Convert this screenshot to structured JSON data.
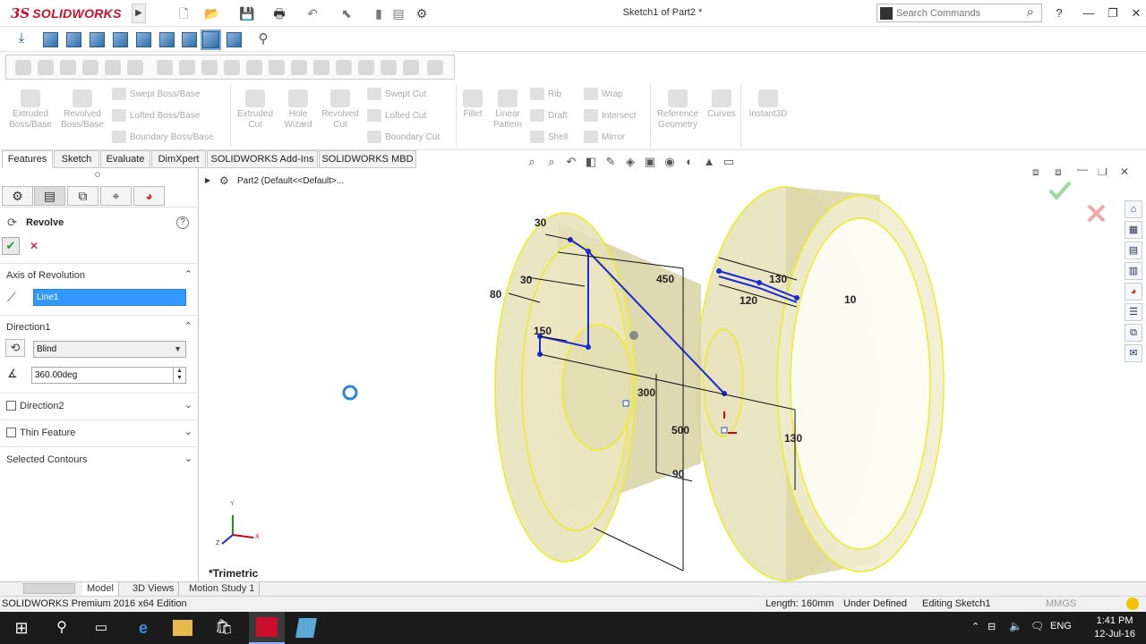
{
  "titlebar": {
    "logo_ds": "3S",
    "logo_text": "SOLIDWORKS",
    "document_title": "Sketch1 of Part2 *",
    "search_placeholder": "Search Commands",
    "help": "?",
    "minimize": "—",
    "restore": "❐",
    "close": "✕"
  },
  "command_manager": {
    "extruded_boss": [
      "Extruded",
      "Boss/Base"
    ],
    "revolved_boss": [
      "Revolved",
      "Boss/Base"
    ],
    "swept_boss": "Swept Boss/Base",
    "lofted_boss": "Lofted Boss/Base",
    "boundary_boss": "Boundary Boss/Base",
    "extruded_cut": [
      "Extruded",
      "Cut"
    ],
    "hole_wizard": [
      "Hole",
      "Wizard"
    ],
    "revolved_cut": [
      "Revolved",
      "Cut"
    ],
    "swept_cut": "Swept Cut",
    "lofted_cut": "Lofted Cut",
    "boundary_cut": "Boundary Cut",
    "fillet": "Fillet",
    "linear_pattern": [
      "Linear",
      "Pattern"
    ],
    "rib": "Rib",
    "draft": "Draft",
    "shell": "Shell",
    "wrap": "Wrap",
    "intersect": "Intersect",
    "mirror": "Mirror",
    "reference_geometry": [
      "Reference",
      "Geometry"
    ],
    "curves": "Curves",
    "instant3d": "Instant3D"
  },
  "tabs": [
    "Features",
    "Sketch",
    "Evaluate",
    "DimXpert",
    "SOLIDWORKS Add-Ins",
    "SOLIDWORKS MBD"
  ],
  "property_manager": {
    "title": "Revolve",
    "help": "?",
    "ok": "✔",
    "cancel": "✕",
    "axis_section": "Axis of Revolution",
    "axis_value": "Line1",
    "direction1_section": "Direction1",
    "direction1_type": "Blind",
    "angle": "360.00deg",
    "direction2": "Direction2",
    "thin_feature": "Thin Feature",
    "selected_contours": "Selected Contours"
  },
  "feature_tree": {
    "part_label": "Part2  (Default<<Default>..."
  },
  "graphics": {
    "view_label": "*Trimetric",
    "dimensions": [
      "30",
      "30",
      "80",
      "150",
      "450",
      "300",
      "500",
      "90",
      "130",
      "120",
      "10",
      "130"
    ],
    "triad": {
      "x": "X",
      "y": "Y",
      "z": "Z"
    },
    "sketch_color": "#1a2bd6",
    "body_fill": "#e6e0b8",
    "edge_highlight": "#f2f200"
  },
  "bottom_tabs": [
    "Model",
    "3D Views",
    "Motion Study 1"
  ],
  "status_bar": {
    "edition": "SOLIDWORKS Premium 2016 x64 Edition",
    "length": "Length: 160mm",
    "state": "Under Defined",
    "editing": "Editing Sketch1",
    "units": "MMGS"
  },
  "taskbar": {
    "language": "ENG",
    "time": "1:41 PM",
    "date": "12-Jul-16"
  }
}
